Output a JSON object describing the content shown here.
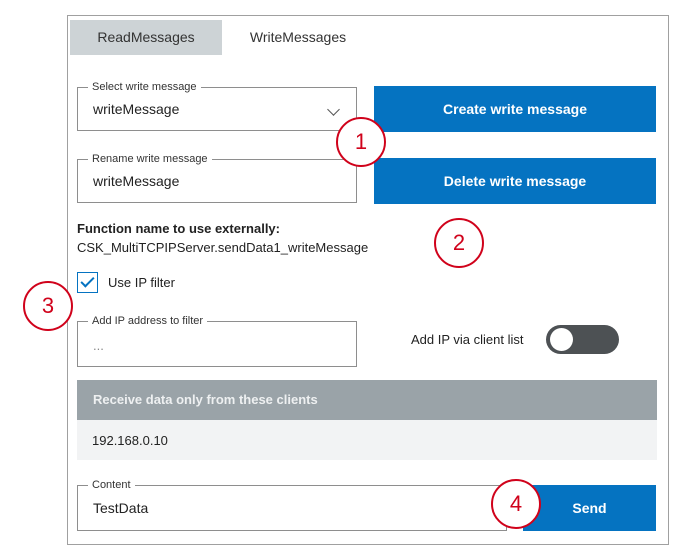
{
  "tabs": [
    {
      "label": "ReadMessages",
      "active": false
    },
    {
      "label": "WriteMessages",
      "active": true
    }
  ],
  "select_write_message": {
    "legend": "Select write message",
    "value": "writeMessage"
  },
  "rename_write_message": {
    "legend": "Rename write message",
    "value": "writeMessage"
  },
  "buttons": {
    "create": "Create write message",
    "delete": "Delete write message",
    "send": "Send"
  },
  "function_name": {
    "label": "Function name to use externally:",
    "value": "CSK_MultiTCPIPServer.sendData1_writeMessage"
  },
  "ip_filter": {
    "label": "Use IP filter",
    "checked": true
  },
  "add_ip": {
    "legend": "Add IP address to filter",
    "placeholder": "..."
  },
  "client_list_toggle": {
    "label": "Add IP via client list",
    "on": false
  },
  "clients_section": {
    "header": "Receive data only from these clients",
    "clients": [
      "192.168.0.10"
    ]
  },
  "content_field": {
    "legend": "Content",
    "value": "TestData"
  },
  "markers": [
    "1",
    "2",
    "3",
    "4"
  ],
  "colors": {
    "primary": "#0573c1",
    "tab_inactive": "#cdd3d6",
    "header_bg": "#9aa3a8",
    "toggle_off": "#4d5154",
    "marker": "#d0021b"
  }
}
